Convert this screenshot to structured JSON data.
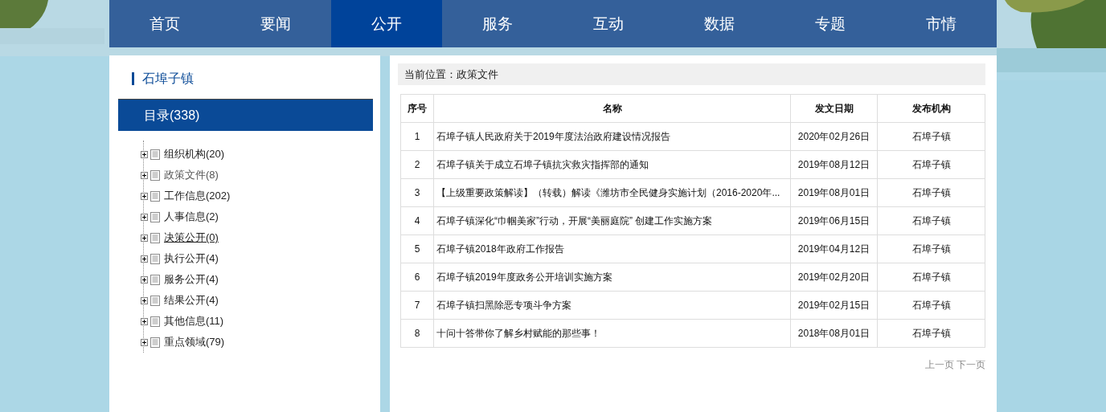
{
  "nav": [
    {
      "label": "首页",
      "selected": false
    },
    {
      "label": "要闻",
      "selected": false
    },
    {
      "label": "公开",
      "selected": true
    },
    {
      "label": "服务",
      "selected": false
    },
    {
      "label": "互动",
      "selected": false
    },
    {
      "label": "数据",
      "selected": false
    },
    {
      "label": "专题",
      "selected": false
    },
    {
      "label": "市情",
      "selected": false
    }
  ],
  "sidebar": {
    "title": "石埠子镇",
    "catalog": "目录(338)",
    "items": [
      {
        "label": "组织机构(20)",
        "selected": false,
        "hovered": false
      },
      {
        "label": "政策文件(8)",
        "selected": true,
        "hovered": false
      },
      {
        "label": "工作信息(202)",
        "selected": false,
        "hovered": false
      },
      {
        "label": "人事信息(2)",
        "selected": false,
        "hovered": false
      },
      {
        "label": "决策公开(0)",
        "selected": false,
        "hovered": true
      },
      {
        "label": "执行公开(4)",
        "selected": false,
        "hovered": false
      },
      {
        "label": "服务公开(4)",
        "selected": false,
        "hovered": false
      },
      {
        "label": "结果公开(4)",
        "selected": false,
        "hovered": false
      },
      {
        "label": "其他信息(11)",
        "selected": false,
        "hovered": false
      },
      {
        "label": "重点领域(79)",
        "selected": false,
        "hovered": false
      }
    ]
  },
  "breadcrumb": "当前位置：政策文件",
  "table": {
    "columns": [
      "序号",
      "名称",
      "发文日期",
      "发布机构"
    ],
    "rows": [
      [
        "1",
        "石埠子镇人民政府关于2019年度法治政府建设情况报告",
        "2020年02月26日",
        "石埠子镇"
      ],
      [
        "2",
        "石埠子镇关于成立石埠子镇抗灾救灾指挥部的通知",
        "2019年08月12日",
        "石埠子镇"
      ],
      [
        "3",
        "【上级重要政策解读】（转载）解读《潍坊市全民健身实施计划（2016-2020年...",
        "2019年08月01日",
        "石埠子镇"
      ],
      [
        "4",
        "石埠子镇深化“巾帼美家”行动，开展“美丽庭院” 创建工作实施方案",
        "2019年06月15日",
        "石埠子镇"
      ],
      [
        "5",
        "石埠子镇2018年政府工作报告",
        "2019年04月12日",
        "石埠子镇"
      ],
      [
        "6",
        "石埠子镇2019年度政务公开培训实施方案",
        "2019年02月20日",
        "石埠子镇"
      ],
      [
        "7",
        "石埠子镇扫黑除恶专项斗争方案",
        "2019年02月15日",
        "石埠子镇"
      ],
      [
        "8",
        "十问十答带你了解乡村赋能的那些事！",
        "2018年08月01日",
        "石埠子镇"
      ]
    ]
  },
  "pagination": {
    "prev": "上一页",
    "next": "下一页"
  }
}
